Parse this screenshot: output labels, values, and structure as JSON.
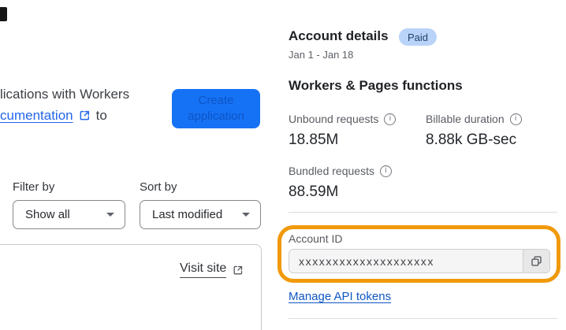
{
  "left": {
    "intro_line1": "lications with Workers",
    "intro_link": "cumentation",
    "intro_after_link": "to",
    "create_button": {
      "line1": "Create",
      "line2": "application"
    },
    "filter_label": "Filter by",
    "filter_value": "Show all",
    "sort_label": "Sort by",
    "sort_value": "Last modified",
    "visit_site_label": "Visit site"
  },
  "account": {
    "title": "Account details",
    "plan_badge": "Paid",
    "date_range": "Jan 1 - Jan 18",
    "section_title": "Workers & Pages functions",
    "metrics": [
      {
        "label": "Unbound requests",
        "value": "18.85M"
      },
      {
        "label": "Billable duration",
        "value": "8.88k GB-sec"
      },
      {
        "label": "Bundled requests",
        "value": "88.59M"
      }
    ],
    "account_id_label": "Account ID",
    "account_id_value": "xxxxxxxxxxxxxxxxxxxx",
    "manage_link": "Manage API tokens"
  },
  "icons": {
    "info_glyph": "i",
    "external_link": "arrow-out-of-box",
    "copy": "two-overlapping-squares",
    "caret": "triangle-down"
  },
  "colors": {
    "accent_blue": "#1672f5",
    "button_text_blue": "#0d55c5",
    "link_blue": "#2465e9",
    "manage_link_blue": "#0f57c4",
    "badge_bg": "#b9d3f9",
    "badge_text": "#22436b",
    "highlight_orange": "#f0990b",
    "divider": "#dcdcdc"
  }
}
